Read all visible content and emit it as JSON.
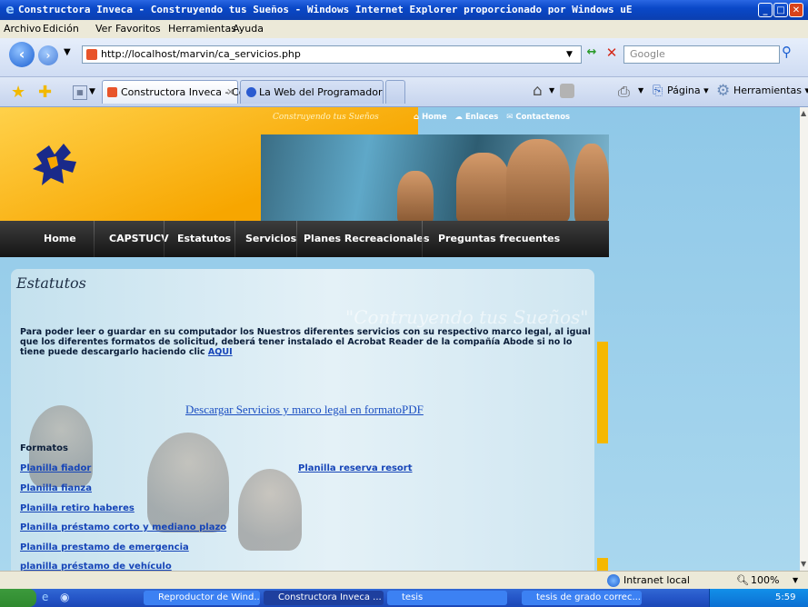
{
  "window": {
    "title": "Constructora Inveca - Construyendo tus Sueños - Windows Internet Explorer proporcionado por Windows uE"
  },
  "menu": [
    "Archivo",
    "Edición",
    "Ver",
    "Favoritos",
    "Herramientas",
    "Ayuda"
  ],
  "address": {
    "url": "http://localhost/marvin/ca_servicios.php",
    "search_placeholder": "Google"
  },
  "tabs": [
    {
      "label": "Constructora Inveca - Co...",
      "active": true
    },
    {
      "label": "La Web del Programador",
      "active": false
    }
  ],
  "toolbar": {
    "page_label": "Página",
    "tools_label": "Herramientas"
  },
  "site": {
    "slogan_top": "Construyendo tus Sueños",
    "top_links": [
      "Home",
      "Enlaces",
      "Contactenos"
    ],
    "nav": [
      "Home",
      "CAPSTUCV",
      "Estatutos",
      "Servicios",
      "Planes Recreacionales",
      "Preguntas frecuentes"
    ],
    "content_title": "Estatutos",
    "watermark": "\"Contruyendo tus Sueños\"",
    "intro": "Para poder leer o guardar en su computador los Nuestros diferentes servicios con su respectivo marco legal, al igual que los diferentes formatos de solicitud, deberá tener instalado el Acrobat Reader de la compañía Abode si no lo tiene puede descargarlo haciendo clic",
    "intro_link": "AQUI",
    "pdf_link": "Descargar Servicios y marco legal en formatoPDF",
    "formatos_heading": "Formatos",
    "formatos_left": [
      "Planilla fiador",
      "Planilla fianza",
      "Planilla retiro haberes",
      "Planilla préstamo corto y mediano plazo",
      "Planilla prestamo de emergencia",
      "planilla préstamo de vehículo"
    ],
    "formatos_right": [
      "Planilla reserva resort"
    ]
  },
  "status": {
    "zone": "Intranet local",
    "zoom": "100%"
  },
  "taskbar": {
    "items": [
      "Reproductor de Wind...",
      "Constructora Inveca ...",
      "tesis",
      "tesis de grado correc..."
    ],
    "clock": "5:59"
  },
  "colors": {
    "title_bar": "#0a48c8",
    "header_orange": "#f7a600",
    "nav_dark": "#1f1f1f",
    "accent_yellow": "#f5b800",
    "link_blue": "#1645b8"
  }
}
